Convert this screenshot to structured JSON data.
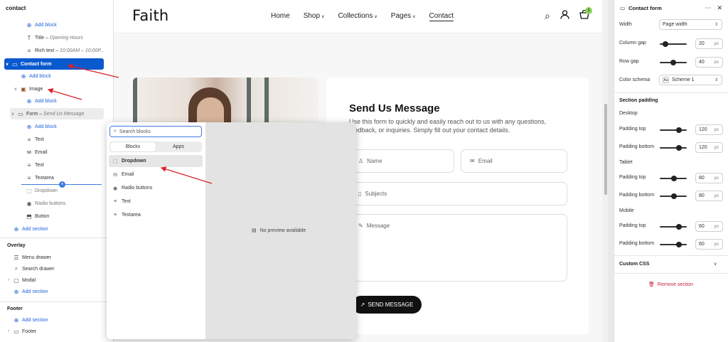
{
  "left": {
    "title": "contact",
    "items": [
      {
        "label": "Add block"
      },
      {
        "label": "Title",
        "sub": "Opening Hours"
      },
      {
        "label": "Rich text",
        "sub": "10:00AM – 10:00P..."
      },
      {
        "label": "Contact form"
      },
      {
        "label": "Add block"
      },
      {
        "label": "Image"
      },
      {
        "label": "Add block"
      },
      {
        "label": "Form",
        "sub": "Send Us Message"
      },
      {
        "label": "Add block"
      },
      {
        "label": "Text"
      },
      {
        "label": "Email"
      },
      {
        "label": "Text"
      },
      {
        "label": "Textarea"
      },
      {
        "label": "Dropdown"
      },
      {
        "label": "Radio buttons"
      },
      {
        "label": "Button"
      },
      {
        "label": "Add section"
      }
    ],
    "overlay": {
      "heading": "Overlay",
      "items": [
        {
          "label": "Menu drawer"
        },
        {
          "label": "Search drawer"
        },
        {
          "label": "Modal"
        },
        {
          "label": "Add section"
        }
      ]
    },
    "footer": {
      "heading": "Footer",
      "items": [
        {
          "label": "Add section"
        },
        {
          "label": "Footer"
        }
      ]
    }
  },
  "store": {
    "logo": "Faith",
    "nav": [
      {
        "label": "Home"
      },
      {
        "label": "Shop"
      },
      {
        "label": "Collections"
      },
      {
        "label": "Pages"
      },
      {
        "label": "Contact"
      }
    ],
    "cart_count": "1",
    "form": {
      "title": "Send Us Message",
      "subtitle": "Use this form to quickly and easily reach out to us with any questions, feedback, or inquiries. Simply fill out your contact details.",
      "name_placeholder": "Name",
      "email_placeholder": "Email",
      "subjects_placeholder": "Subjects",
      "message_placeholder": "Message",
      "button": "SEND MESSAGE"
    }
  },
  "picker": {
    "search_placeholder": "Search blocks",
    "tabs": [
      "Blocks",
      "Apps"
    ],
    "items": [
      "Dropdown",
      "Email",
      "Radio buttons",
      "Text",
      "Textarea"
    ],
    "no_preview": "No preview available"
  },
  "settings": {
    "title": "Contact form",
    "width_label": "Width",
    "width_value": "Page width",
    "column_gap_label": "Column gap",
    "column_gap_value": "20",
    "row_gap_label": "Row gap",
    "row_gap_value": "40",
    "color_schema_label": "Color schema",
    "color_schema_value": "Scheme 1",
    "section_padding": "Section padding",
    "desktop": "Desktop",
    "tablet": "Tablet",
    "mobile": "Mobile",
    "padding_top": "Padding top",
    "padding_bottom": "Padding bottom",
    "desktop_top": "120",
    "desktop_bottom": "120",
    "tablet_top": "80",
    "tablet_bottom": "80",
    "mobile_top": "60",
    "mobile_bottom": "60",
    "unit": "px",
    "custom_css": "Custom CSS",
    "remove_section": "Remove section"
  },
  "colors": {
    "selected": "#0b59cf",
    "link": "#1f63d8",
    "annotation_arrow": "#d8242d",
    "cart_badge": "#8bd35a",
    "danger": "#c4243a"
  }
}
